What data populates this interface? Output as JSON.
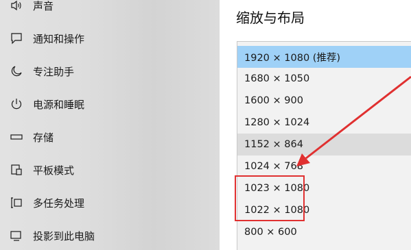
{
  "sidebar": {
    "items": [
      {
        "label": "声音",
        "icon": "speaker-icon"
      },
      {
        "label": "通知和操作",
        "icon": "notification-icon"
      },
      {
        "label": "专注助手",
        "icon": "moon-icon"
      },
      {
        "label": "电源和睡眠",
        "icon": "power-icon"
      },
      {
        "label": "存储",
        "icon": "storage-icon"
      },
      {
        "label": "平板模式",
        "icon": "tablet-icon"
      },
      {
        "label": "多任务处理",
        "icon": "multitask-icon"
      },
      {
        "label": "投影到此电脑",
        "icon": "project-icon"
      }
    ]
  },
  "main": {
    "section_title": "缩放与布局",
    "resolution_options": [
      {
        "label": "1920 × 1080 (推荐)",
        "state": "selected"
      },
      {
        "label": "1680 × 1050",
        "state": ""
      },
      {
        "label": "1600 × 900",
        "state": ""
      },
      {
        "label": "1280 × 1024",
        "state": ""
      },
      {
        "label": "1152 × 864",
        "state": "hover"
      },
      {
        "label": "1024 × 768",
        "state": ""
      },
      {
        "label": "1023 × 1080",
        "state": ""
      },
      {
        "label": "1022 × 1080",
        "state": ""
      },
      {
        "label": "800 × 600",
        "state": ""
      }
    ]
  },
  "colors": {
    "selected": "#9fd1f7",
    "annotation": "#e03030"
  }
}
